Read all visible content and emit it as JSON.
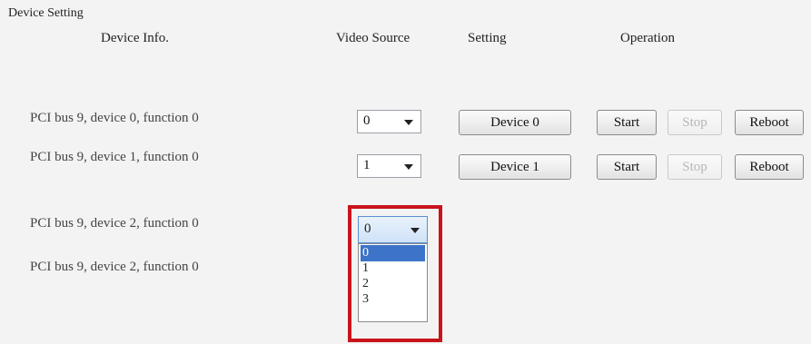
{
  "group_title": "Device Setting",
  "columns": {
    "device_info": "Device Info.",
    "video_source": "Video Source",
    "setting": "Setting",
    "operation": "Operation"
  },
  "devices": [
    {
      "info": "PCI bus 9, device 0, function 0",
      "source": "0",
      "setting": "Device 0",
      "start": "Start",
      "stop": "Stop",
      "reboot": "Reboot"
    },
    {
      "info": "PCI bus 9, device 1, function 0",
      "source": "1",
      "setting": "Device 1",
      "start": "Start",
      "stop": "Stop",
      "reboot": "Reboot"
    },
    {
      "info": "PCI bus 9, device 2, function 0",
      "source": "0"
    },
    {
      "info": "PCI bus 9, device 2, function 0"
    }
  ],
  "dropdown_options": [
    "0",
    "1",
    "2",
    "3"
  ],
  "colors": {
    "highlight": "#c8141b",
    "selected_option": "#3d74c9"
  }
}
